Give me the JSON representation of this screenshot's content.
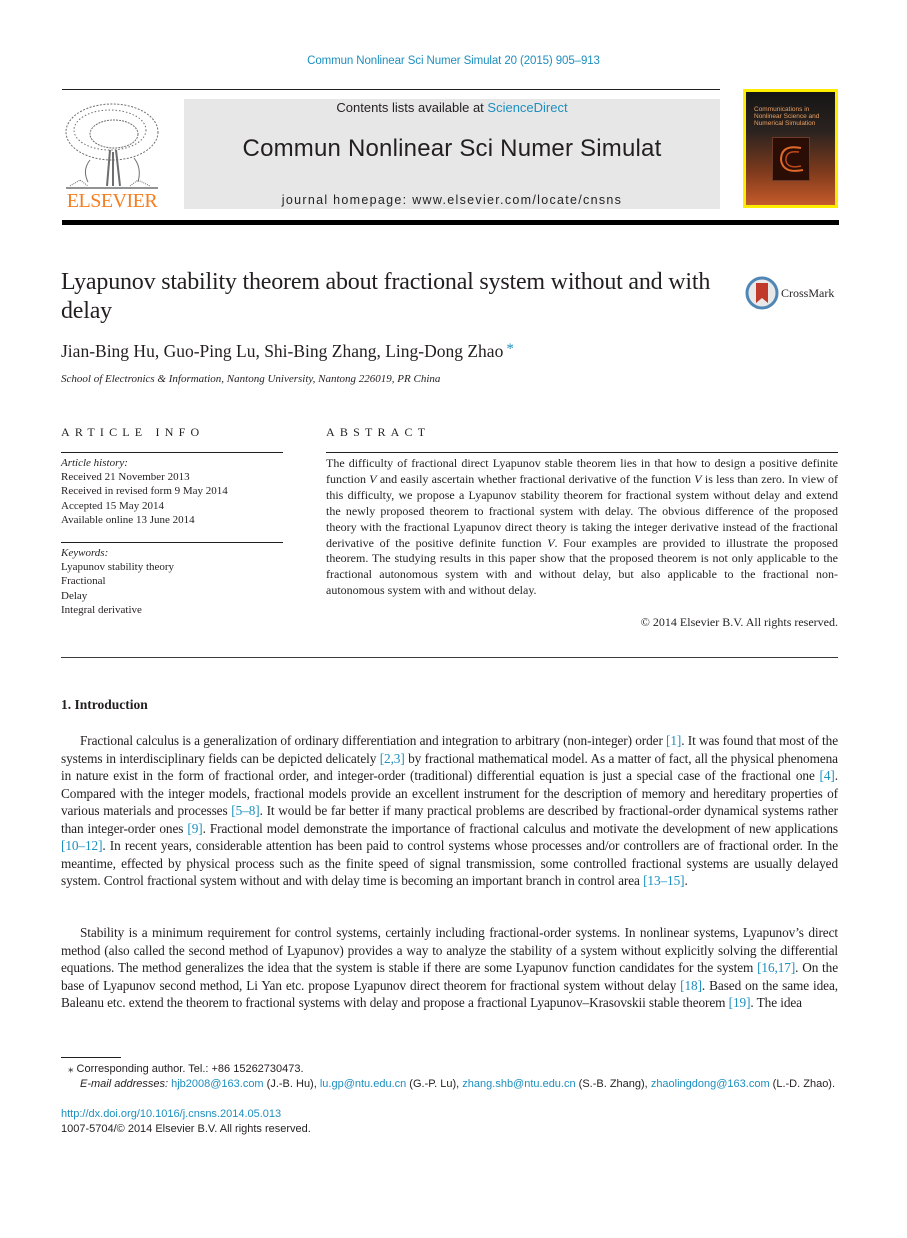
{
  "header": {
    "running_head": "Commun Nonlinear Sci Numer Simulat 20 (2015) 905–913",
    "contents_prefix": "Contents lists available at ",
    "contents_link": "ScienceDirect",
    "journal_title": "Commun Nonlinear Sci Numer Simulat",
    "homepage_prefix": "journal homepage: ",
    "homepage_url": "www.elsevier.com/locate/cnsns",
    "publisher_wordmark": "ELSEVIER",
    "cover_title": "Communications in Nonlinear Science and Numerical Simulation",
    "crossmark_label": "CrossMark"
  },
  "article": {
    "title": "Lyapunov stability theorem about fractional system without and with delay",
    "authors": "Jian-Bing Hu, Guo-Ping Lu, Shi-Bing Zhang, Ling-Dong Zhao",
    "corresponding_marker": "*",
    "affiliation": "School of Electronics & Information, Nantong University, Nantong 226019, PR China"
  },
  "article_info": {
    "label": "ARTICLE INFO",
    "history_heading": "Article history:",
    "history": [
      "Received 21 November 2013",
      "Received in revised form 9 May 2014",
      "Accepted 15 May 2014",
      "Available online 13 June 2014"
    ],
    "keywords_heading": "Keywords:",
    "keywords": [
      "Lyapunov stability theory",
      "Fractional",
      "Delay",
      "Integral derivative"
    ]
  },
  "abstract": {
    "label": "ABSTRACT",
    "parts": [
      "The difficulty of fractional direct Lyapunov stable theorem lies in that how to design a positive definite function ",
      "V",
      " and easily ascertain whether fractional derivative of the function ",
      "V",
      " is less than zero. In view of this difficulty, we propose a Lyapunov stability theorem for fractional system without delay and extend the newly proposed theorem to fractional system with delay. The obvious difference of the proposed theory with the fractional Lyapunov direct theory is taking the integer derivative instead of the fractional derivative of the positive definite function ",
      "V",
      ". Four examples are provided to illustrate the proposed theorem. The studying results in this paper show that the proposed theorem is not only applicable to the fractional autonomous system with and without delay, but also applicable to the fractional non-autonomous system with and without delay."
    ],
    "copyright": "© 2014 Elsevier B.V. All rights reserved."
  },
  "body": {
    "section_heading": "1. Introduction",
    "para1": [
      "Fractional calculus is a generalization of ordinary differentiation and integration to arbitrary (non-integer) order ",
      "[1]",
      ". It was found that most of the systems in interdisciplinary fields can be depicted delicately ",
      "[2,3]",
      " by fractional mathematical model. As a matter of fact, all the physical phenomena in nature exist in the form of fractional order, and integer-order (traditional) differential equation is just a special case of the fractional one ",
      "[4]",
      ". Compared with the integer models, fractional models provide an excellent instrument for the description of memory and hereditary properties of various materials and processes ",
      "[5–8]",
      ". It would be far better if many practical problems are described by fractional-order dynamical systems rather than integer-order ones ",
      "[9]",
      ". Fractional model demonstrate the importance of fractional calculus and motivate the development of new applications ",
      "[10–12]",
      ". In recent years, considerable attention has been paid to control systems whose processes and/or controllers are of fractional order. In the meantime, effected by physical process such as the finite speed of signal transmission, some controlled fractional systems are usually delayed system. Control fractional system without and with delay time is becoming an important branch in control area ",
      "[13–15]",
      "."
    ],
    "para2": [
      "Stability is a minimum requirement for control systems, certainly including fractional-order systems. In nonlinear systems, Lyapunov’s direct method (also called the second method of Lyapunov) provides a way to analyze the stability of a system without explicitly solving the differential equations. The method generalizes the idea that the system is stable if there are some Lyapunov function candidates for the system ",
      "[16,17]",
      ". On the base of Lyapunov second method, Li Yan etc. propose Lyapunov direct theorem for fractional system without delay ",
      "[18]",
      ". Based on the same idea, Baleanu etc. extend the theorem to fractional systems with delay and propose a fractional Lyapunov–Krasovskii stable theorem ",
      "[19]",
      ". The idea"
    ]
  },
  "footnotes": {
    "corresponding": "⁎ Corresponding author. Tel.: +86 15262730473.",
    "email_lead": "E-mail addresses: ",
    "emails": [
      {
        "address": "hjb2008@163.com",
        "who": " (J.-B. Hu), "
      },
      {
        "address": "lu.gp@ntu.edu.cn",
        "who": " (G.-P. Lu), "
      },
      {
        "address": "zhang.shb@ntu.edu.cn",
        "who": " (S.-B. Zhang), "
      },
      {
        "address": "zhaolingdong@163.com",
        "who": " (L.-D. Zhao)."
      }
    ],
    "doi": "http://dx.doi.org/10.1016/j.cnsns.2014.05.013",
    "issn": "1007-5704/© 2014 Elsevier B.V. All rights reserved."
  },
  "colors": {
    "link": "#1d8fbf",
    "elsevier_orange": "#f47e20",
    "masthead_gray": "#e7e7e8",
    "cover_yellow": "#ffed00"
  }
}
